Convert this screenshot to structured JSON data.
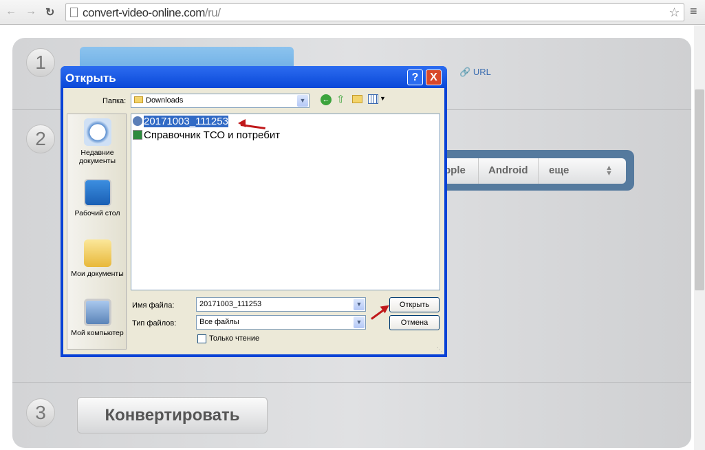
{
  "browser": {
    "url_host": "convert-video-online.com",
    "url_path": "/ru/"
  },
  "page": {
    "steps": [
      "1",
      "2",
      "3"
    ],
    "url_link": "URL",
    "formats": [
      "pple",
      "Android",
      "еще"
    ],
    "convert_label": "Конвертировать"
  },
  "dialog": {
    "title": "Открыть",
    "help": "?",
    "close": "X",
    "folder_label": "Папка:",
    "folder_value": "Downloads",
    "places": [
      "Недавние документы",
      "Рабочий стол",
      "Мои документы",
      "Мой компьютер"
    ],
    "files": [
      {
        "name": "20171003_111253",
        "icon": "media-file-icon",
        "selected": true
      },
      {
        "name": "Справочник ТСО и потребит",
        "icon": "excel-file-icon",
        "selected": false
      }
    ],
    "filename_label": "Имя файла:",
    "filename_value": "20171003_111253",
    "filetype_label": "Тип файлов:",
    "filetype_value": "Все файлы",
    "readonly_label": "Только чтение",
    "open_button": "Открыть",
    "cancel_button": "Отмена"
  },
  "colors": {
    "xp_title": "#0a48d8",
    "selection": "#316ac5",
    "annotation_arrow": "#c0181a"
  }
}
